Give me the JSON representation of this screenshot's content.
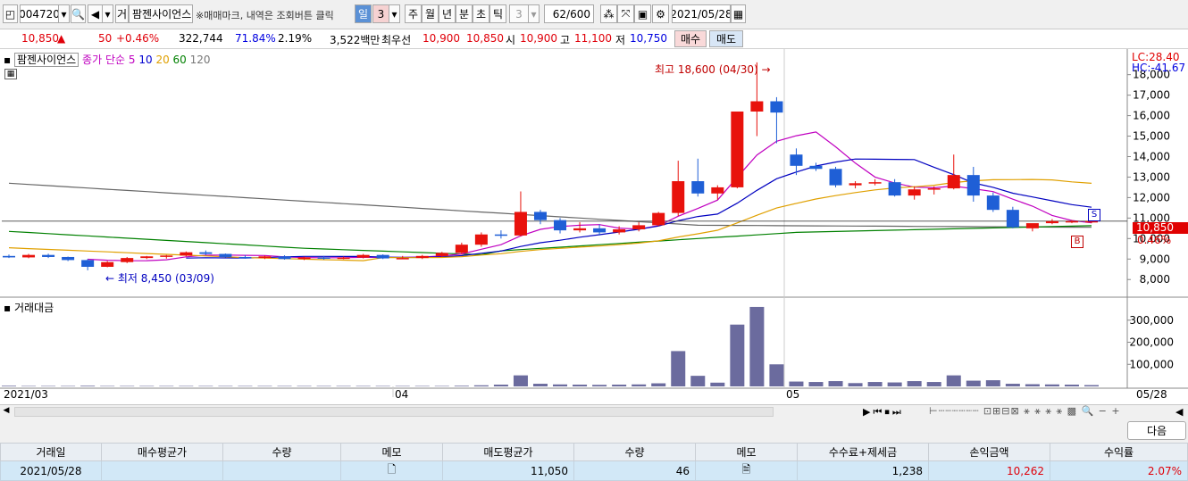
{
  "toolbar": {
    "code": "004720",
    "type_btn": "거",
    "stock_name": "팜젠사이언스",
    "marker_hint": "※매매마크, 내역은 조회버튼 클릭",
    "period_tabs": [
      "일",
      "3",
      "주",
      "월",
      "년",
      "분",
      "초",
      "틱"
    ],
    "tick_value": "3",
    "count": "62/600",
    "date": "2021/05/28"
  },
  "quote": {
    "price": "10,850",
    "up_mark": "▲",
    "change": "50",
    "change_pct": "+0.46%",
    "volume": "322,744",
    "vol_ratio": "71.84%",
    "turnover": "2.19%",
    "amount": "3,522백만",
    "best_label": "최우선",
    "ask": "10,900",
    "bid": "10,850",
    "open_label": "시",
    "open": "10,900",
    "high_label": "고",
    "high": "11,100",
    "low_label": "저",
    "low": "10,750",
    "buy_btn": "매수",
    "sell_btn": "매도"
  },
  "legend": {
    "name": "팜젠사이언스",
    "ma_label": "종가 단순",
    "periods": [
      "5",
      "10",
      "20",
      "60",
      "120"
    ],
    "volume_label": "거래대금"
  },
  "annotations": {
    "high": "최고 18,600 (04/30)",
    "low": "최저 8,450 (03/09)",
    "lc": "LC:28.40",
    "hc": "HC:-41.67",
    "price_tag": "10,850",
    "pct_tag": "0.46%",
    "sell_marker": "S",
    "buy_marker": "B"
  },
  "axis": {
    "price_ticks": [
      "18,000",
      "17,000",
      "16,000",
      "15,000",
      "14,000",
      "13,000",
      "12,000",
      "11,000",
      "10,000",
      "9,000",
      "8,000"
    ],
    "vol_ticks": [
      "300,000",
      "200,000",
      "100,000"
    ],
    "date_labels": [
      "2021/03",
      "04",
      "05",
      "05/28"
    ]
  },
  "chart_data": {
    "type": "candlestick",
    "ylim": [
      7600,
      18600
    ],
    "candles": [
      [
        9150,
        9220,
        9050,
        9080
      ],
      [
        9080,
        9250,
        9040,
        9200
      ],
      [
        9200,
        9260,
        9050,
        9100
      ],
      [
        9100,
        9120,
        8900,
        8950
      ],
      [
        8950,
        9000,
        8450,
        8620
      ],
      [
        8620,
        8900,
        8600,
        8850
      ],
      [
        8850,
        9100,
        8800,
        9050
      ],
      [
        9050,
        9150,
        9000,
        9130
      ],
      [
        9130,
        9200,
        9020,
        9170
      ],
      [
        9170,
        9370,
        9130,
        9330
      ],
      [
        9330,
        9420,
        9200,
        9250
      ],
      [
        9250,
        9270,
        9080,
        9100
      ],
      [
        9100,
        9200,
        9020,
        9050
      ],
      [
        9050,
        9170,
        9000,
        9130
      ],
      [
        9130,
        9180,
        8970,
        9000
      ],
      [
        9000,
        9120,
        8950,
        9080
      ],
      [
        9080,
        9150,
        8970,
        9050
      ],
      [
        9050,
        9120,
        8990,
        9070
      ],
      [
        9070,
        9250,
        9030,
        9200
      ],
      [
        9200,
        9230,
        9000,
        9030
      ],
      [
        9030,
        9150,
        9000,
        9050
      ],
      [
        9050,
        9200,
        9000,
        9150
      ],
      [
        9150,
        9350,
        9100,
        9300
      ],
      [
        9300,
        9800,
        9250,
        9700
      ],
      [
        9700,
        10300,
        9600,
        10200
      ],
      [
        10200,
        10400,
        10000,
        10150
      ],
      [
        10150,
        12300,
        10100,
        11300
      ],
      [
        11300,
        11400,
        10700,
        10900
      ],
      [
        10900,
        11000,
        10250,
        10400
      ],
      [
        10400,
        10800,
        10300,
        10500
      ],
      [
        10500,
        10700,
        10150,
        10300
      ],
      [
        10300,
        10600,
        10200,
        10450
      ],
      [
        10450,
        10800,
        10350,
        10650
      ],
      [
        10650,
        11300,
        10600,
        11250
      ],
      [
        11250,
        13800,
        11100,
        12800
      ],
      [
        12800,
        13900,
        12050,
        12200
      ],
      [
        12200,
        12600,
        11900,
        12500
      ],
      [
        12500,
        15500,
        12450,
        16200
      ],
      [
        16200,
        18600,
        15000,
        16700
      ],
      [
        16700,
        16900,
        14650,
        16150
      ],
      [
        14100,
        14400,
        13100,
        13550
      ],
      [
        13550,
        13700,
        13300,
        13400
      ],
      [
        13400,
        13500,
        12500,
        12600
      ],
      [
        12600,
        12800,
        12450,
        12700
      ],
      [
        12700,
        12900,
        12600,
        12750
      ],
      [
        12750,
        12900,
        12050,
        12100
      ],
      [
        12100,
        12550,
        11900,
        12400
      ],
      [
        12400,
        12550,
        12150,
        12450
      ],
      [
        12450,
        14100,
        12400,
        13100
      ],
      [
        13100,
        13500,
        11800,
        12100
      ],
      [
        12100,
        12250,
        11300,
        11400
      ],
      [
        11400,
        11550,
        10500,
        10550
      ],
      [
        10500,
        10600,
        10350,
        10750
      ],
      [
        10750,
        10950,
        10700,
        10850
      ],
      [
        10850,
        10900,
        10750,
        10850
      ],
      [
        10850,
        11100,
        10750,
        10850
      ]
    ],
    "volume": [
      3000,
      2000,
      2000,
      2000,
      3000,
      2000,
      2000,
      2000,
      2000,
      2000,
      2000,
      2000,
      2000,
      2000,
      2000,
      2000,
      2000,
      2000,
      2000,
      2000,
      2000,
      2000,
      2000,
      3000,
      5000,
      8000,
      50000,
      12000,
      9000,
      8000,
      7000,
      8000,
      9000,
      14000,
      160000,
      48000,
      17000,
      280000,
      360000,
      100000,
      22000,
      20000,
      24000,
      15000,
      20000,
      18000,
      24000,
      20000,
      50000,
      26000,
      28000,
      12000,
      10000,
      9000,
      8000,
      6000
    ]
  }
}
